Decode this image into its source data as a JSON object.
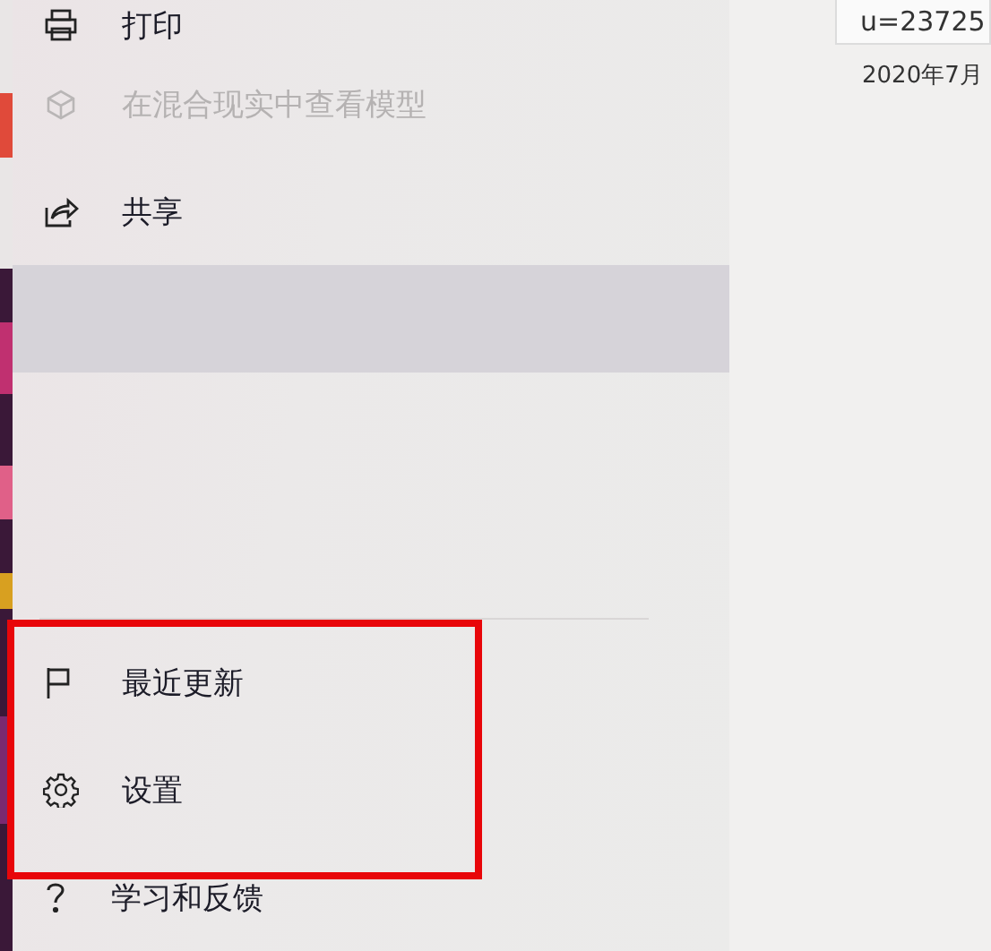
{
  "menu": {
    "top_items": [
      {
        "kind": "item",
        "label": "打印",
        "disabled": false,
        "selected": false
      },
      {
        "kind": "item",
        "label": "在混合现实中查看模型",
        "disabled": true,
        "selected": false
      },
      {
        "kind": "item",
        "label": "共享",
        "disabled": false,
        "selected": false
      },
      {
        "kind": "blank",
        "selected": true
      }
    ],
    "bottom_items": [
      {
        "kind": "item",
        "label": "最近更新",
        "disabled": false,
        "selected": false
      },
      {
        "kind": "item",
        "label": "设置",
        "disabled": false,
        "selected": false
      },
      {
        "kind": "item",
        "label": "学习和反馈",
        "disabled": false,
        "selected": false
      }
    ]
  },
  "file_panel": {
    "name_field": "u=23725",
    "date": "2020年7月"
  }
}
